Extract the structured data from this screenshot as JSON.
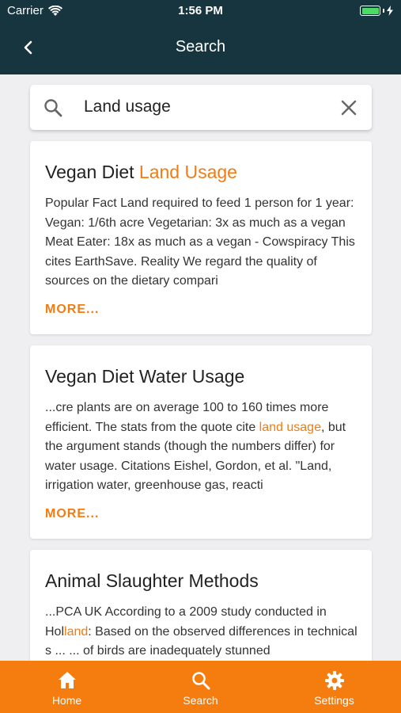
{
  "status_bar": {
    "carrier": "Carrier",
    "time": "1:56 PM"
  },
  "nav": {
    "title": "Search"
  },
  "search": {
    "value": "Land usage",
    "placeholder": ""
  },
  "results": [
    {
      "title_plain": "Vegan Diet ",
      "title_highlight": "Land Usage",
      "snippet": " Popular Fact Land required to feed 1 person for 1 year: Vegan: 1/6th acre Vegetarian: 3x as much as a vegan Meat Eater: 18x as much as a vegan - Cowspiracy  This cites EarthSave.  Reality We regard the quality of sources on the dietary compari",
      "more_label": "MORE..."
    },
    {
      "title_plain": "Vegan Diet Water Usage",
      "snippet_before": " ...cre plants are on average 100 to 160 times more efficient.  The stats from the quote cite ",
      "snippet_highlight": "land usage",
      "snippet_after": ", but the argument stands (though the numbers differ) for water usage.  Citations  Eishel, Gordon, et al. \"Land, irrigation water, greenhouse gas, reacti",
      "more_label": "MORE..."
    },
    {
      "title_plain": "Animal Slaughter Methods",
      "snippet_before": " ...PCA UK  According to a 2009 study conducted in Hol",
      "snippet_highlight": "land",
      "snippet_after": ": Based on the observed differences in technical s ...  ... of birds are inadequately stunned"
    }
  ],
  "tabs": [
    {
      "label": "Home",
      "icon": "home-icon"
    },
    {
      "label": "Search",
      "icon": "search-icon"
    },
    {
      "label": "Settings",
      "icon": "gear-icon"
    }
  ],
  "colors": {
    "nav_bg": "#17353f",
    "accent": "#f57c0f",
    "highlight": "#f07c13",
    "battery": "#4cd964"
  }
}
